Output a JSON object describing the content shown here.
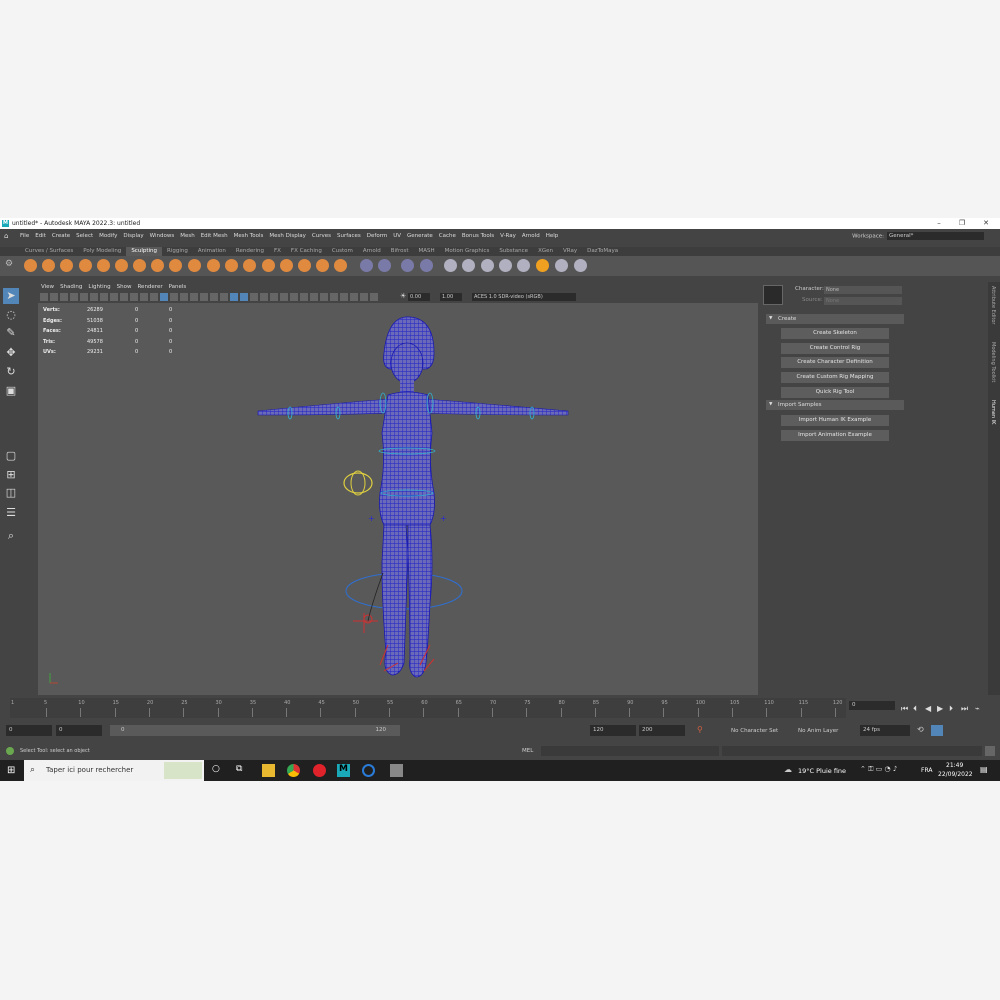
{
  "titlebar": {
    "title": "untitled* - Autodesk MAYA 2022.3: untitled",
    "logo": "M"
  },
  "menubar": {
    "items": [
      "File",
      "Edit",
      "Create",
      "Select",
      "Modify",
      "Display",
      "Windows",
      "Mesh",
      "Edit Mesh",
      "Mesh Tools",
      "Mesh Display",
      "Curves",
      "Surfaces",
      "Deform",
      "UV",
      "Generate",
      "Cache",
      "Bonus Tools",
      "V-Ray",
      "Arnold",
      "Help"
    ],
    "workspace_label": "Workspace:",
    "workspace_value": "General*"
  },
  "shelf_tabs": [
    "Curves / Surfaces",
    "Poly Modeling",
    "Sculpting",
    "Rigging",
    "Animation",
    "Rendering",
    "FX",
    "FX Caching",
    "Custom",
    "Arnold",
    "Bifrost",
    "MASH",
    "Motion Graphics",
    "Substance",
    "XGen",
    "VRay",
    "DazToMaya"
  ],
  "active_shelf_tab": "Sculpting",
  "panel_menu": [
    "View",
    "Shading",
    "Lighting",
    "Show",
    "Renderer",
    "Panels"
  ],
  "panel_toolbar": {
    "exposure": "0.00",
    "gamma": "1.00",
    "color_space": "ACES 1.0 SDR-video (sRGB)"
  },
  "hud": [
    {
      "label": "Verts:",
      "v1": "26289",
      "v2": "0",
      "v3": "0"
    },
    {
      "label": "Edges:",
      "v1": "51038",
      "v2": "0",
      "v3": "0"
    },
    {
      "label": "Faces:",
      "v1": "24811",
      "v2": "0",
      "v3": "0"
    },
    {
      "label": "Tris:",
      "v1": "49578",
      "v2": "0",
      "v3": "0"
    },
    {
      "label": "UVs:",
      "v1": "29231",
      "v2": "0",
      "v3": "0"
    }
  ],
  "human_ik": {
    "character_label": "Character:",
    "character_value": "None",
    "source_label": "Source:",
    "source_value": "None",
    "create_section": "Create",
    "create_buttons": [
      "Create Skeleton",
      "Create Control Rig",
      "Create Character Definition",
      "Create Custom Rig Mapping",
      "Quick Rig Tool"
    ],
    "samples_section": "Import Samples",
    "sample_buttons": [
      "Import Human IK Example",
      "Import Animation Example"
    ]
  },
  "side_tabs": [
    "Attribute Editor",
    "Modeling Toolkit",
    "Human IK"
  ],
  "timeline": {
    "ticks": [
      "5",
      "10",
      "15",
      "20",
      "25",
      "30",
      "35",
      "40",
      "45",
      "50",
      "55",
      "60",
      "65",
      "70",
      "75",
      "80",
      "85",
      "90",
      "95",
      "100",
      "105",
      "110",
      "115",
      "120"
    ],
    "start_mark": "1",
    "current_frame": "0"
  },
  "range": {
    "start": "0",
    "anim_start": "0",
    "slider_start": "0",
    "slider_end": "120",
    "playback_end": "120",
    "anim_end": "200",
    "character_set": "No Character Set",
    "anim_layer": "No Anim Layer",
    "fps": "24 fps"
  },
  "cmdline": {
    "status": "Select Tool: select an object",
    "lang": "MEL"
  },
  "taskbar": {
    "search_placeholder": "Taper ici pour rechercher",
    "weather": "19°C  Pluie fine",
    "lang": "FRA",
    "time": "21:49",
    "date": "22/09/2022"
  },
  "colors": {
    "accent": "#5286b9",
    "maya_teal": "#1aa9b8",
    "viewport": "#595959",
    "mesh": "#2a2ad0"
  }
}
